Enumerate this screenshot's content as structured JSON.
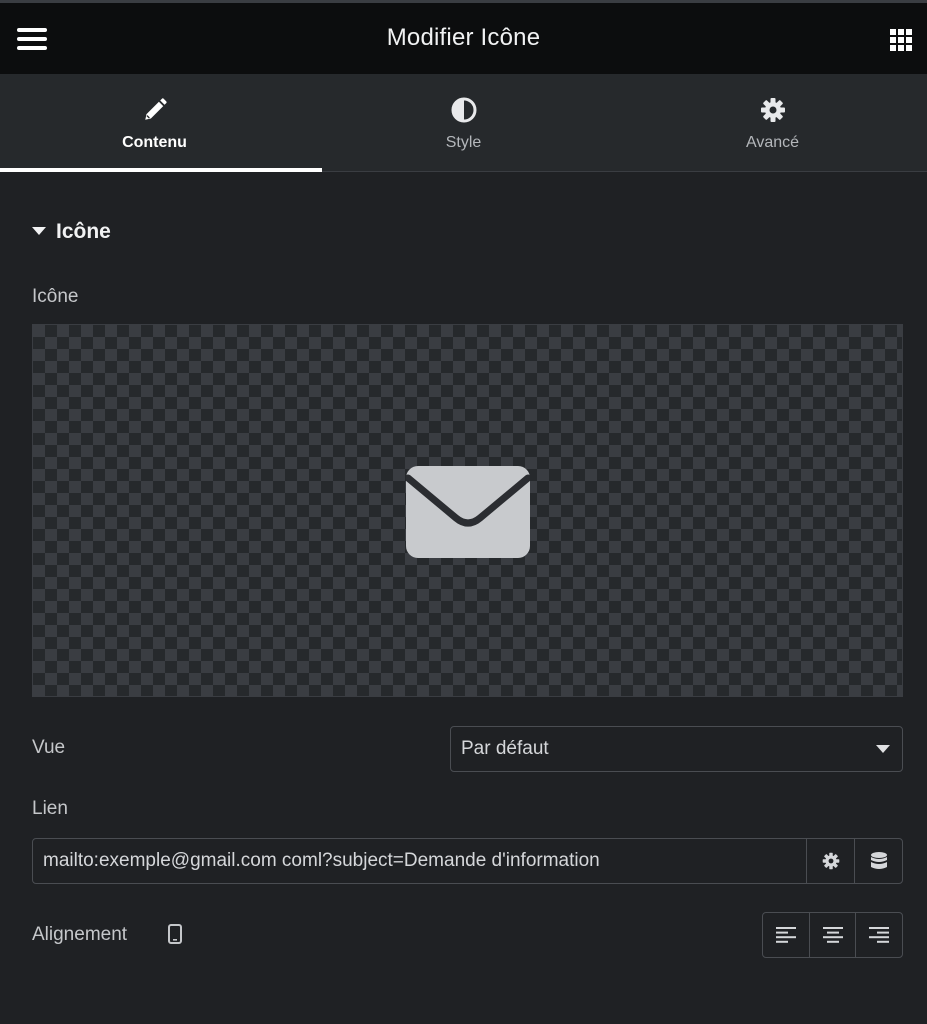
{
  "header": {
    "title": "Modifier Icône",
    "menu_icon": "hamburger-menu-icon",
    "apps_icon": "grid-apps-icon"
  },
  "tabs": [
    {
      "label": "Contenu",
      "icon": "pencil-icon",
      "active": true
    },
    {
      "label": "Style",
      "icon": "half-circle-icon",
      "active": false
    },
    {
      "label": "Avancé",
      "icon": "gear-icon",
      "active": false
    }
  ],
  "section": {
    "title": "Icône",
    "toggle_icon": "caret-down-icon"
  },
  "icon_field": {
    "label": "Icône",
    "preview_icon": "envelope-icon"
  },
  "view_field": {
    "label": "Vue",
    "value": "Par défaut"
  },
  "link_field": {
    "label": "Lien",
    "value": "mailto:exemple@gmail.com coml?subject=Demande d'information",
    "settings_icon": "gear-icon",
    "dynamic_icon": "database-icon"
  },
  "alignment_field": {
    "label": "Alignement",
    "device_icon": "mobile-device-icon",
    "options": [
      "align-left-icon",
      "align-center-icon",
      "align-right-icon"
    ]
  },
  "colors": {
    "panel_bg": "#1f2124",
    "header_bg": "#0c0d0e",
    "tabs_bg": "#26292c",
    "border": "#4a4d52",
    "icon_gray": "#c5c7ca"
  }
}
